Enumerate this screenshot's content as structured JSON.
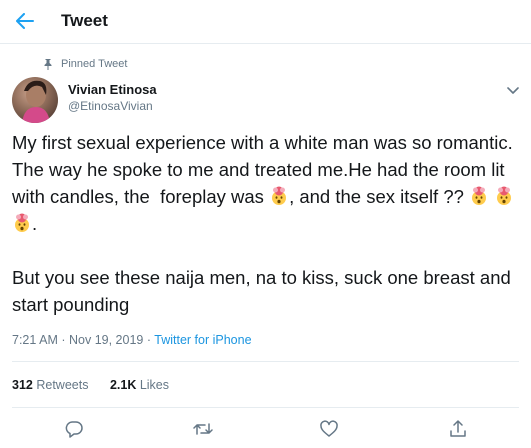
{
  "header": {
    "title": "Tweet"
  },
  "tweet": {
    "pinned_label": "Pinned Tweet",
    "author_name": "Vivian Etinosa",
    "author_handle": "@EtinosaVivian",
    "paragraph1_part1": "My first sexual experience with a white man was so romantic. The way he spoke to me and treated me.He had the room lit with candles, the  foreplay was ",
    "paragraph1_part2": ", and the sex itself ?? ",
    "paragraph1_part3": ".",
    "paragraph2": "But you see these naija men, na to kiss, suck one breast and start pounding",
    "time": "7:21 AM",
    "date": "Nov 19, 2019",
    "source": "Twitter for iPhone",
    "retweets_count": "312",
    "retweets_label": "Retweets",
    "likes_count": "2.1K",
    "likes_label": "Likes"
  },
  "colors": {
    "accent": "#1da1f2",
    "muted": "#657786",
    "text": "#14171a",
    "border": "#e6ecf0"
  },
  "icons": {
    "back": "arrow-left-icon",
    "pin": "pin-icon",
    "caret": "chevron-down-icon",
    "emoji": "exploding-head-emoji",
    "reply": "reply-icon",
    "retweet": "retweet-icon",
    "like": "heart-icon",
    "share": "share-icon"
  }
}
